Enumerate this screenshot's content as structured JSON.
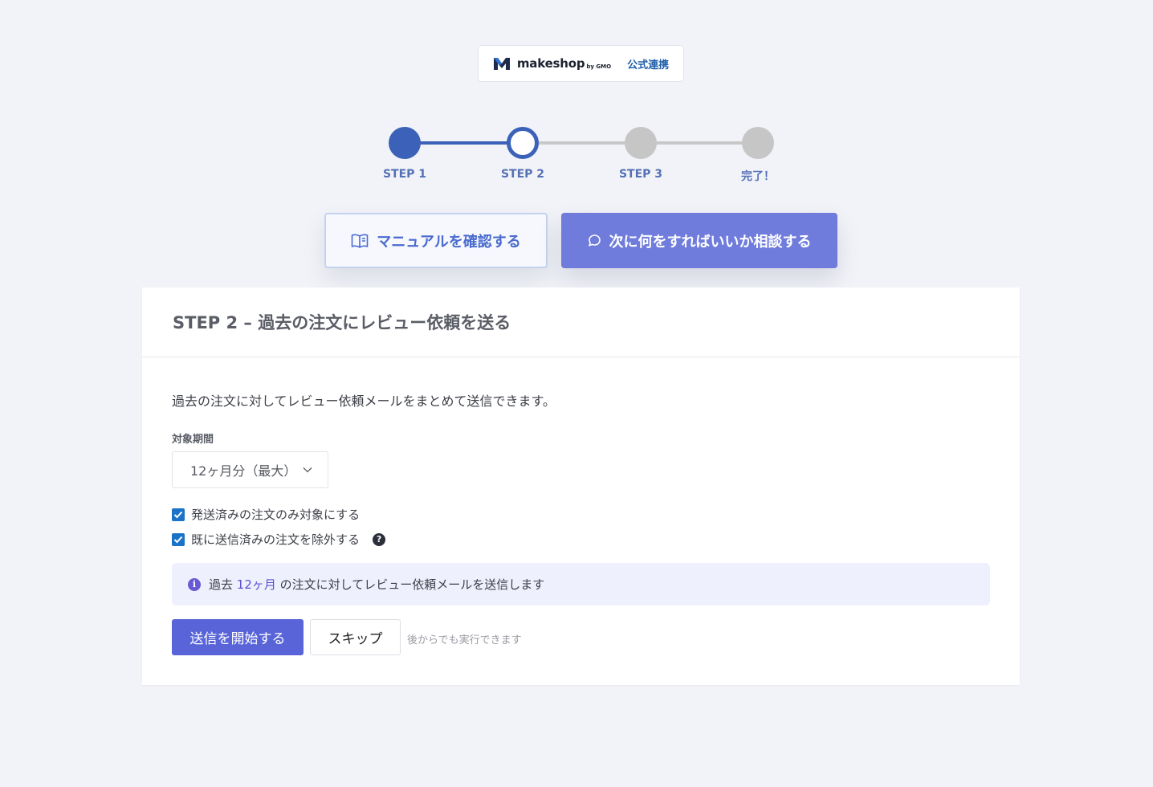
{
  "badge": {
    "brand": "makeshop",
    "brand_sub": "by GMO",
    "label": "公式連携",
    "logo_icon": "makeshop-logo-icon"
  },
  "stepper": {
    "steps": [
      {
        "label": "STEP 1",
        "state": "done"
      },
      {
        "label": "STEP 2",
        "state": "current"
      },
      {
        "label": "STEP 3",
        "state": "todo"
      },
      {
        "label": "完了！",
        "state": "todo"
      }
    ],
    "active_color": "#3b62b8",
    "inactive_color": "#c6c6c6"
  },
  "actions": {
    "manual_label": "マニュアルを確認する",
    "manual_icon": "book-icon",
    "consult_label": "次に何をすればいいか相談する",
    "consult_icon": "chat-bubble-icon"
  },
  "card": {
    "title": "STEP 2 – 過去の注文にレビュー依頼を送る",
    "description": "過去の注文に対してレビュー依頼メールをまとめて送信できます。",
    "period": {
      "label": "対象期間",
      "selected": "12ヶ月分（最大）"
    },
    "checkboxes": [
      {
        "label": "発送済みの注文のみ対象にする",
        "checked": true
      },
      {
        "label": "既に送信済みの注文を除外する",
        "checked": true
      }
    ],
    "notice": {
      "prefix": "過去",
      "highlight": "12ヶ月",
      "suffix": "の注文に対してレビュー依頼メールを送信します"
    },
    "start_label": "送信を開始する",
    "skip_label": "スキップ",
    "later_note": "後からでも実行できます"
  }
}
